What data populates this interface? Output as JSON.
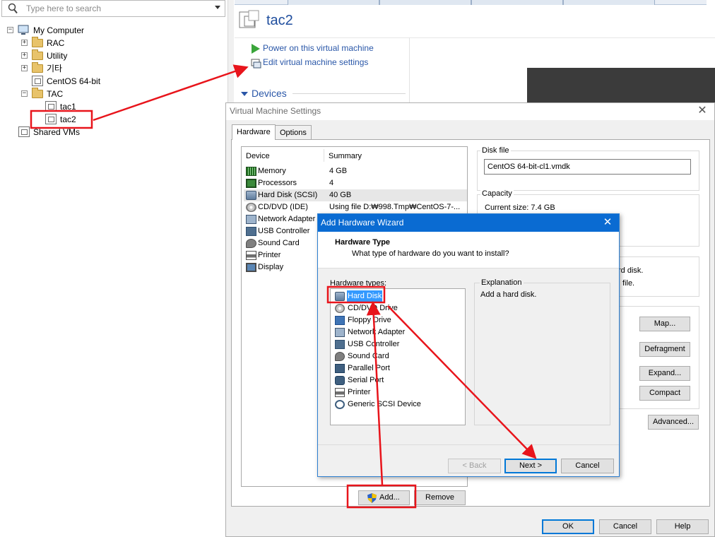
{
  "library": {
    "search_placeholder": "Type here to search",
    "tree": [
      {
        "label": "My Computer",
        "expander": "−"
      },
      {
        "label": "RAC",
        "expander": "+"
      },
      {
        "label": "Utility",
        "expander": "+"
      },
      {
        "label": "기타",
        "expander": "+"
      },
      {
        "label": "CentOS 64-bit",
        "expander": ""
      },
      {
        "label": "TAC",
        "expander": "−"
      },
      {
        "label": "tac1",
        "expander": ""
      },
      {
        "label": "tac2",
        "expander": ""
      },
      {
        "label": "Shared VMs",
        "expander": ""
      }
    ]
  },
  "vm": {
    "title": "tac2",
    "power_on": "Power on this virtual machine",
    "edit_settings": "Edit virtual machine settings",
    "devices_header": "Devices"
  },
  "settings_dialog": {
    "title": "Virtual Machine Settings",
    "tabs": [
      "Hardware",
      "Options"
    ],
    "columns": {
      "device": "Device",
      "summary": "Summary"
    },
    "devices": [
      {
        "name": "Memory",
        "summary": "4 GB",
        "icon": "memory-icon"
      },
      {
        "name": "Processors",
        "summary": "4",
        "icon": "processor-icon"
      },
      {
        "name": "Hard Disk (SCSI)",
        "summary": "40 GB",
        "icon": "hard-disk-icon"
      },
      {
        "name": "CD/DVD (IDE)",
        "summary": "Using file D:₩998.Tmp₩CentOS-7-...",
        "icon": "cd-dvd-icon"
      },
      {
        "name": "Network Adapter",
        "summary": "",
        "icon": "network-adapter-icon"
      },
      {
        "name": "USB Controller",
        "summary": "",
        "icon": "usb-icon"
      },
      {
        "name": "Sound Card",
        "summary": "",
        "icon": "sound-card-icon"
      },
      {
        "name": "Printer",
        "summary": "",
        "icon": "printer-icon"
      },
      {
        "name": "Display",
        "summary": "",
        "icon": "display-icon"
      }
    ],
    "disk_file": {
      "label": "Disk file",
      "value": "CentOS 64-bit-cl1.vmdk"
    },
    "capacity": {
      "label": "Capacity",
      "current_size": "Current size:  7.4 GB"
    },
    "partial_text_1": "rd disk.",
    "partial_text_2": "file.",
    "buttons": {
      "map": "Map...",
      "defragment": "Defragment",
      "expand": "Expand...",
      "compact": "Compact",
      "advanced": "Advanced...",
      "add": "Add...",
      "remove": "Remove",
      "ok": "OK",
      "cancel": "Cancel",
      "help": "Help"
    }
  },
  "wizard": {
    "title": "Add Hardware Wizard",
    "header_title": "Hardware Type",
    "header_subtitle": "What type of hardware do you want to install?",
    "list_label": "Hardware types:",
    "hardware_types": [
      {
        "name": "Hard Disk",
        "icon": "hard-disk-icon",
        "selected": true
      },
      {
        "name": "CD/DVD Drive",
        "icon": "cd-dvd-icon",
        "selected": false
      },
      {
        "name": "Floppy Drive",
        "icon": "floppy-icon",
        "selected": false
      },
      {
        "name": "Network Adapter",
        "icon": "network-adapter-icon",
        "selected": false
      },
      {
        "name": "USB Controller",
        "icon": "usb-icon",
        "selected": false
      },
      {
        "name": "Sound Card",
        "icon": "sound-card-icon",
        "selected": false
      },
      {
        "name": "Parallel Port",
        "icon": "parallel-port-icon",
        "selected": false
      },
      {
        "name": "Serial Port",
        "icon": "serial-port-icon",
        "selected": false
      },
      {
        "name": "Printer",
        "icon": "printer-icon",
        "selected": false
      },
      {
        "name": "Generic SCSI Device",
        "icon": "scsi-icon",
        "selected": false
      }
    ],
    "explanation_title": "Explanation",
    "explanation_text": "Add a hard disk.",
    "buttons": {
      "back": "< Back",
      "next": "Next >",
      "cancel": "Cancel"
    }
  },
  "colors": {
    "annotation": "#e8141b",
    "link": "#2a57a8",
    "wizard_title": "#0a6bd2",
    "selection": "#3399ff"
  }
}
